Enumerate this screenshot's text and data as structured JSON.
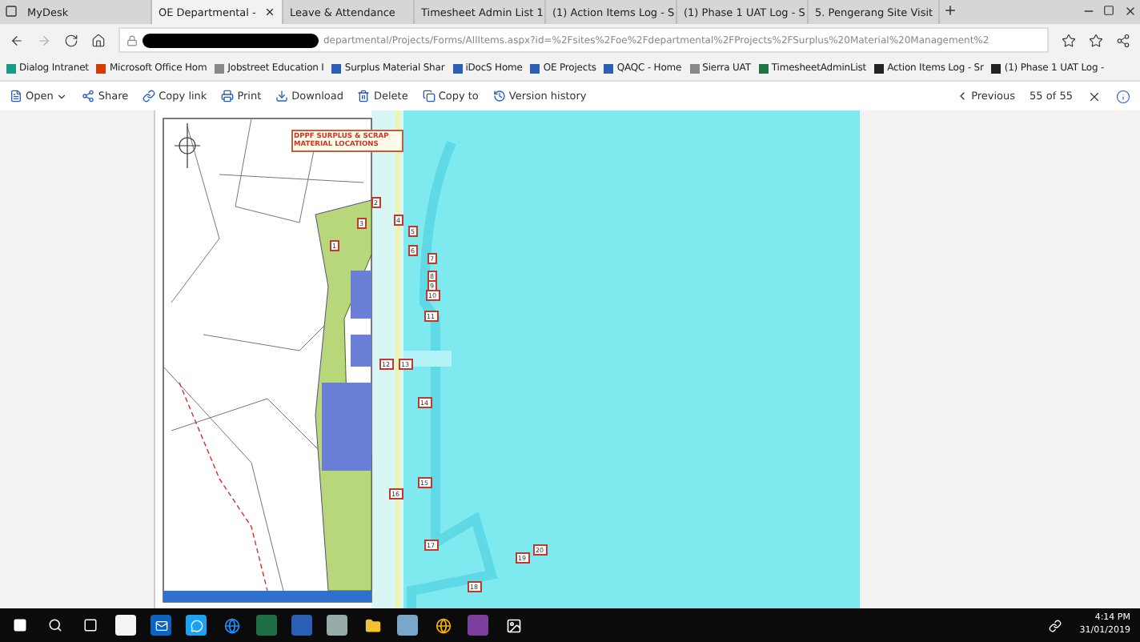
{
  "browser_tabs": [
    {
      "label": "MyDesk",
      "selected": false
    },
    {
      "label": "OE Departmental -",
      "selected": true
    },
    {
      "label": "Leave & Attendance",
      "selected": false
    },
    {
      "label": "Timesheet Admin List 1",
      "selected": false
    },
    {
      "label": "(1) Action Items Log - S",
      "selected": false
    },
    {
      "label": "(1) Phase 1 UAT Log - S",
      "selected": false
    },
    {
      "label": "5. Pengerang Site Visit",
      "selected": false
    }
  ],
  "address_bar": {
    "url": "departmental/Projects/Forms/AllItems.aspx?id=%2Fsites%2Foe%2Fdepartmental%2FProjects%2FSurplus%20Material%20Management%2"
  },
  "bookmarks": [
    "Dialog Intranet",
    "Microsoft Office Hom",
    "Jobstreet Education I",
    "Surplus Material Shar",
    "iDocS Home",
    "OE Projects",
    "QAQC - Home",
    "Sierra UAT",
    "TimesheetAdminList",
    "Action Items Log - Sr",
    "(1) Phase 1 UAT Log -"
  ],
  "toolbar": {
    "actions": [
      "Open",
      "Share",
      "Copy link",
      "Print",
      "Download",
      "Delete",
      "Copy to",
      "Version history"
    ],
    "previous": "Previous",
    "position": "55 of 55"
  },
  "document": {
    "title": "DPPF SURPLUS & SCRAP MATERIAL LOCATIONS",
    "markers": [
      "2",
      "3",
      "1",
      "4",
      "5",
      "6",
      "7",
      "8",
      "9",
      "10",
      "11",
      "12",
      "13",
      "14",
      "15",
      "16",
      "17",
      "19",
      "20",
      "18"
    ]
  },
  "taskbar": {
    "time": "4:14 PM",
    "date": "31/01/2019"
  }
}
